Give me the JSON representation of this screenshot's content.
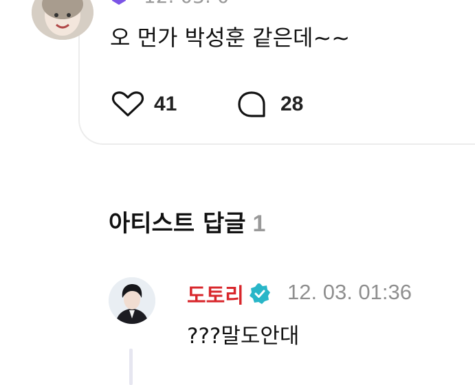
{
  "comment": {
    "time_partial": "12. 03. 0",
    "text": "오 먼가 박성훈 같은데~~",
    "likes": "41",
    "replies": "28"
  },
  "artist_replies": {
    "title": "아티스트 답글",
    "count": "1",
    "items": [
      {
        "author": "도토리",
        "verified": true,
        "time": "12. 03. 01:36",
        "text": "???말도안대"
      }
    ]
  },
  "colors": {
    "author_name": "#d8262b",
    "verified_badge": "#29b6c8",
    "count_grey": "#999999"
  },
  "icons": [
    "heart-icon",
    "comment-bubble-icon",
    "verified-badge-icon"
  ]
}
